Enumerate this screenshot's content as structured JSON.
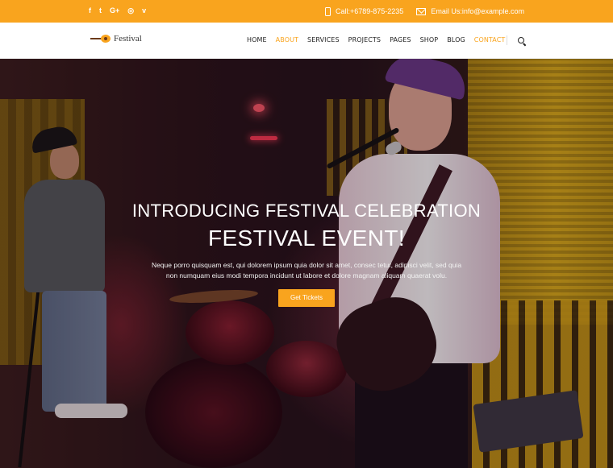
{
  "topbar": {
    "social": [
      {
        "icon": "facebook-icon",
        "glyph": "f"
      },
      {
        "icon": "twitter-icon",
        "glyph": "t"
      },
      {
        "icon": "google-plus-icon",
        "glyph": "G+"
      },
      {
        "icon": "dribbble-icon",
        "glyph": "◎"
      },
      {
        "icon": "vimeo-icon",
        "glyph": "v"
      }
    ],
    "phone": "Call:+6789-875-2235",
    "email": "Email Us:info@example.com",
    "bg_color": "#f9a41e"
  },
  "header": {
    "logo_text": "Festival",
    "nav": [
      {
        "label": "HOME",
        "active": false
      },
      {
        "label": "ABOUT",
        "active": true
      },
      {
        "label": "SERVICES",
        "active": false
      },
      {
        "label": "PROJECTS",
        "active": false
      },
      {
        "label": "PAGES",
        "active": false
      },
      {
        "label": "SHOP",
        "active": false
      },
      {
        "label": "BLOG",
        "active": false
      },
      {
        "label": "CONTACT",
        "active": true
      }
    ],
    "accent_color": "#f9a41e"
  },
  "hero": {
    "subtitle": "INTRODUCING FESTIVAL CELEBRATION",
    "title": "FESTIVAL EVENT!",
    "description": "Neque porro quisquam est, qui dolorem ipsum quia dolor sit amet, consec tetur, adipisci velit, sed quia non numquam eius modi tempora incidunt ut labore et dolore magnam aliquam quaerat volu.",
    "button_label": "Get Tickets"
  }
}
